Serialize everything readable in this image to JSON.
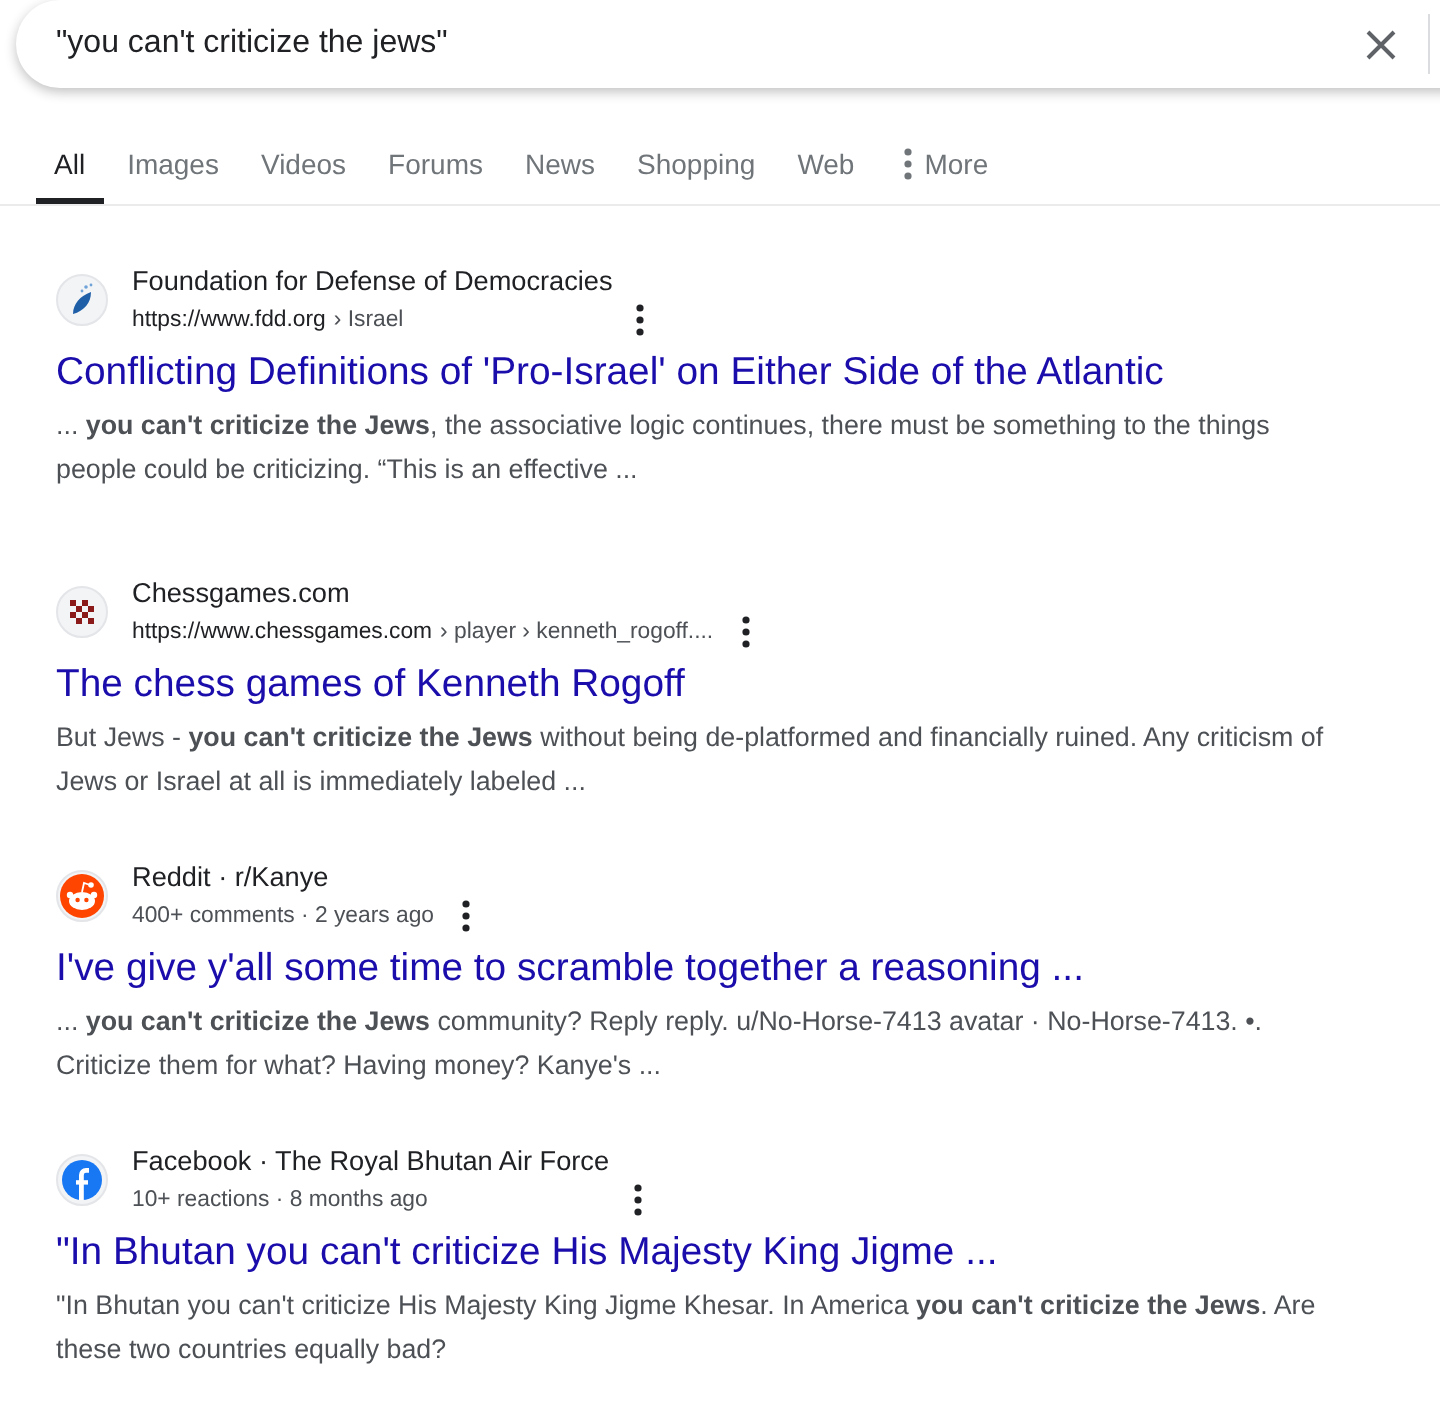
{
  "search": {
    "query": "\"you can't criticize the jews\""
  },
  "tabs": [
    {
      "label": "All",
      "selected": true,
      "kind": "tab"
    },
    {
      "label": "Images",
      "selected": false,
      "kind": "tab"
    },
    {
      "label": "Videos",
      "selected": false,
      "kind": "tab"
    },
    {
      "label": "Forums",
      "selected": false,
      "kind": "tab"
    },
    {
      "label": "News",
      "selected": false,
      "kind": "tab"
    },
    {
      "label": "Shopping",
      "selected": false,
      "kind": "tab"
    },
    {
      "label": "Web",
      "selected": false,
      "kind": "tab"
    },
    {
      "label": "More",
      "selected": false,
      "kind": "menu"
    }
  ],
  "results": [
    {
      "site": "Foundation for Defense of Democracies",
      "url": "https://www.fdd.org",
      "breadcrumb": "› Israel",
      "title": "Conflicting Definitions of 'Pro-Israel' on Either Side of the Atlantic",
      "snippet": "... **you can't criticize the Jews**, the associative logic continues, there must be something to the things people could be criticizing. “This is an effective ..."
    },
    {
      "site": "Chessgames.com",
      "url": "https://www.chessgames.com",
      "breadcrumb": "› player › kenneth_rogoff....",
      "title": "The chess games of Kenneth Rogoff",
      "snippet": "But Jews - **you can't criticize the Jews** without being de-platformed and financially ruined. Any criticism of Jews or Israel at all is immediately labeled ..."
    },
    {
      "site": "Reddit · r/Kanye",
      "meta": "400+ comments · 2 years ago",
      "title": "I've give y'all some time to scramble together a reasoning ...",
      "snippet": "... **you can't criticize the Jews** community? Reply reply. u/No-Horse-7413 avatar · No-Horse-7413. •. Criticize them for what? Having money? Kanye's ..."
    },
    {
      "site": "Facebook · The Royal Bhutan Air Force",
      "meta": "10+ reactions · 8 months ago",
      "title": "\"In Bhutan you can't criticize His Majesty King Jigme ...",
      "snippet": "\"In Bhutan you can't criticize His Majesty King Jigme Khesar. In America **you can't criticize the Jews**. Are these two countries equally bad?"
    }
  ]
}
